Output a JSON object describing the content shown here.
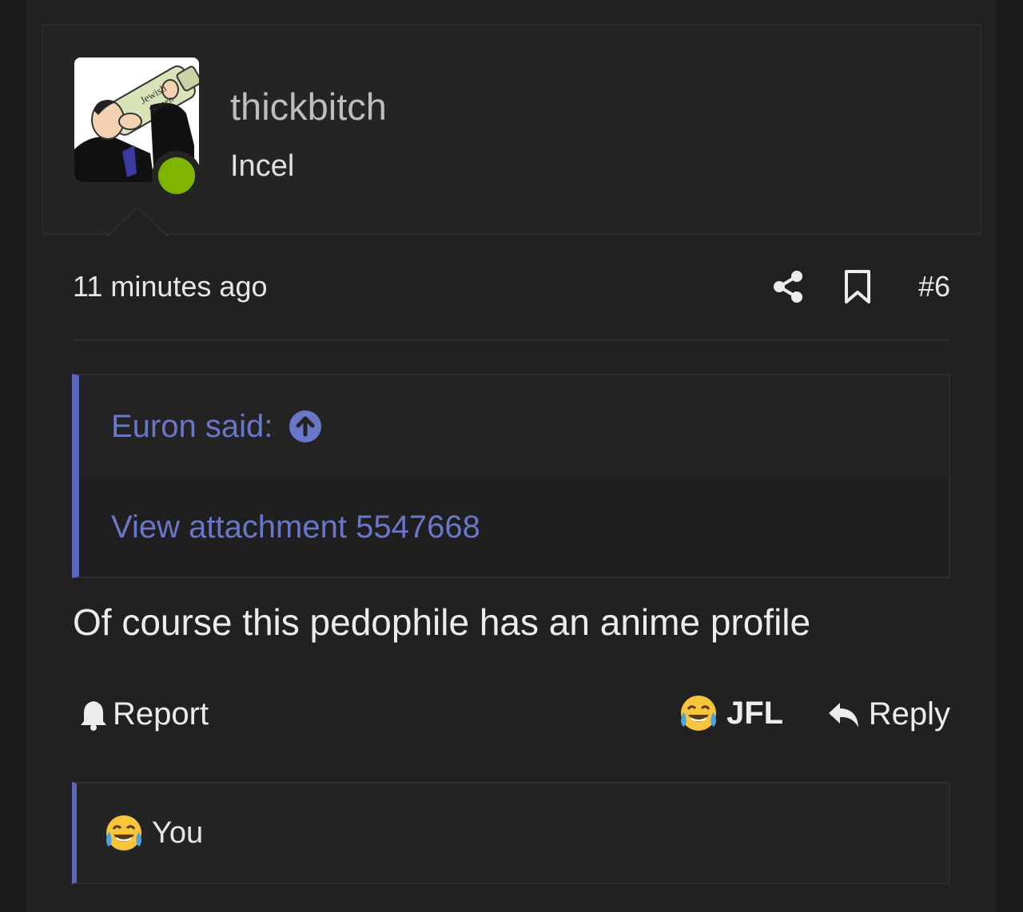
{
  "user": {
    "name": "thickbitch",
    "title": "Incel",
    "avatar_caption": "Jewish Semen",
    "online_color": "#7fb500"
  },
  "post": {
    "time": "11 minutes ago",
    "number": "#6",
    "message": "Of course this pedophile has an anime profile"
  },
  "quote": {
    "author_label": "Euron said:",
    "attachment_text": "View attachment 5547668",
    "accent_color": "#5b67bd"
  },
  "actions": {
    "report_label": "Report",
    "reaction_label": "JFL",
    "reply_label": "Reply"
  },
  "reactions": {
    "user_label": "You",
    "icon": "face-with-tears-of-joy-icon"
  },
  "icons": {
    "share": "share-icon",
    "bookmark": "bookmark-icon",
    "quote_jump": "arrow-up-circle-icon",
    "report": "bell-icon",
    "reply": "reply-arrow-icon"
  }
}
